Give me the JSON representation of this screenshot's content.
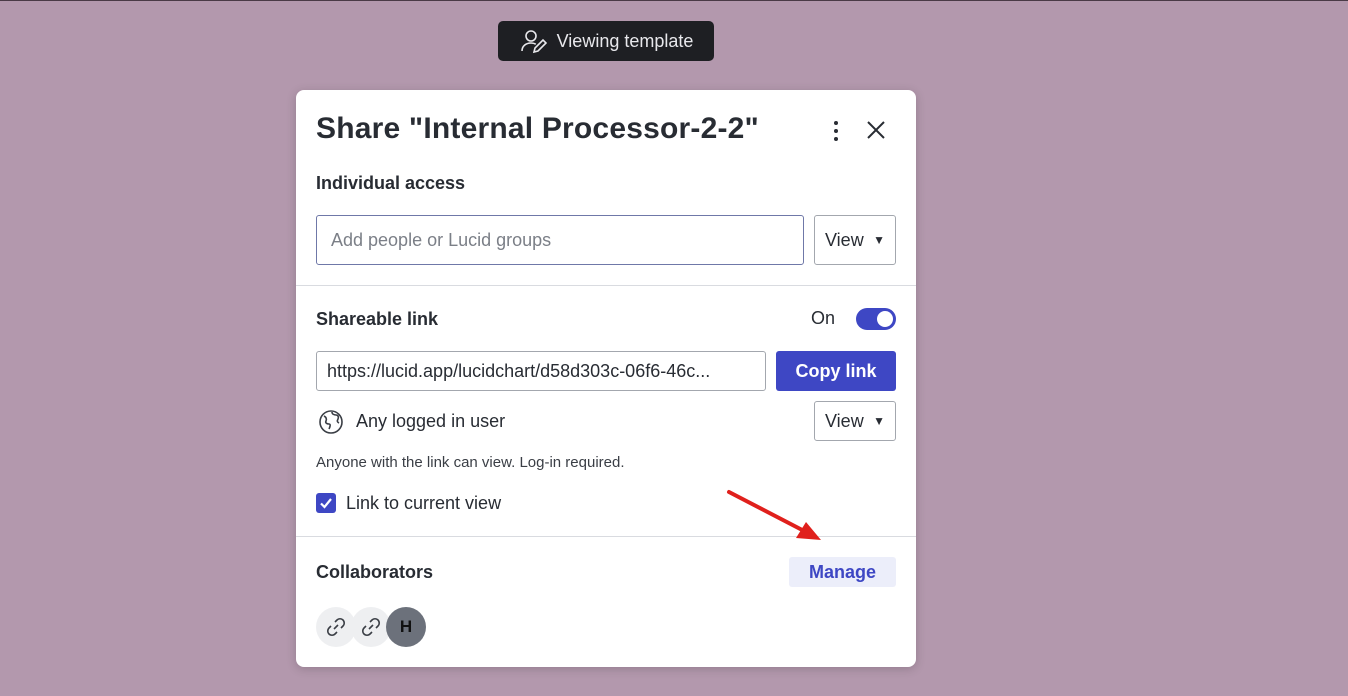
{
  "banner": {
    "label": "Viewing template"
  },
  "dialog": {
    "title": "Share \"Internal Processor-2-2\"",
    "individual_access": {
      "heading": "Individual access",
      "input_placeholder": "Add people or Lucid groups",
      "permission": "View"
    },
    "shareable_link": {
      "heading": "Shareable link",
      "toggle_label": "On",
      "url": "https://lucid.app/lucidchart/d58d303c-06f6-46c...",
      "copy_label": "Copy link",
      "audience": "Any logged in user",
      "permission": "View",
      "help": "Anyone with the link can view. Log-in required.",
      "current_view_label": "Link to current view",
      "current_view_checked": true
    },
    "collaborators": {
      "heading": "Collaborators",
      "manage_label": "Manage",
      "avatars": [
        {
          "type": "link-icon"
        },
        {
          "type": "link-icon"
        },
        {
          "type": "initial",
          "text": "H"
        }
      ]
    }
  },
  "colors": {
    "background": "#b398ad",
    "accent": "#3e47c4",
    "annotation_arrow": "#e0201c"
  }
}
